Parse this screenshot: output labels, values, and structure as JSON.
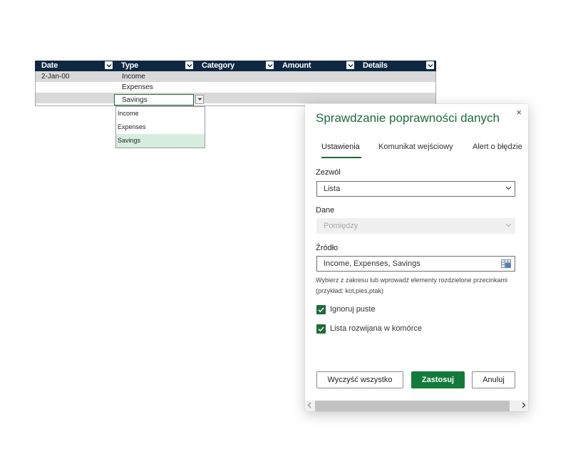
{
  "table": {
    "headers": [
      "Date",
      "Type",
      "Category",
      "Amount",
      "Details"
    ],
    "rows": [
      {
        "date": "2-Jan-00",
        "type": "Income"
      },
      {
        "date": "",
        "type": "Expenses"
      },
      {
        "date": "",
        "type": "Savings"
      }
    ],
    "dropdown_options": [
      "Income",
      "Expenses",
      "Savings"
    ],
    "dropdown_selected": "Savings"
  },
  "pane": {
    "title": "Sprawdzanie poprawności danych",
    "close": "×",
    "tabs": [
      "Ustawienia",
      "Komunikat wejściowy",
      "Alert o błędzie"
    ],
    "active_tab": "Ustawienia",
    "allow_label": "Zezwól",
    "allow_value": "Lista",
    "data_label": "Dane",
    "data_value": "Pomiędzy",
    "source_label": "Źródło",
    "source_value": "Income, Expenses, Savings",
    "hint": "Wybierz z zakresu lub wprowadź elementy rozdzielone przecinkami (przykład: kot,pies,ptak)",
    "ignore_blank": "Ignoruj puste",
    "ignore_blank_checked": true,
    "in_cell_dropdown": "Lista rozwijana w komórce",
    "in_cell_dropdown_checked": true,
    "clear_all": "Wyczyść wszystko",
    "apply": "Zastosuj",
    "cancel": "Anuluj"
  },
  "colors": {
    "header_bg": "#0e2841",
    "accent": "#1e6b3a",
    "primary_button": "#137a3b",
    "row_shade": "#d9d9d9",
    "dropdown_selected": "#d6eedf"
  },
  "icons": [
    "filter-dropdown-icon",
    "chevron-down-icon",
    "close-icon",
    "range-select-icon",
    "checkmark-icon",
    "scroll-left-icon",
    "scroll-right-icon"
  ]
}
